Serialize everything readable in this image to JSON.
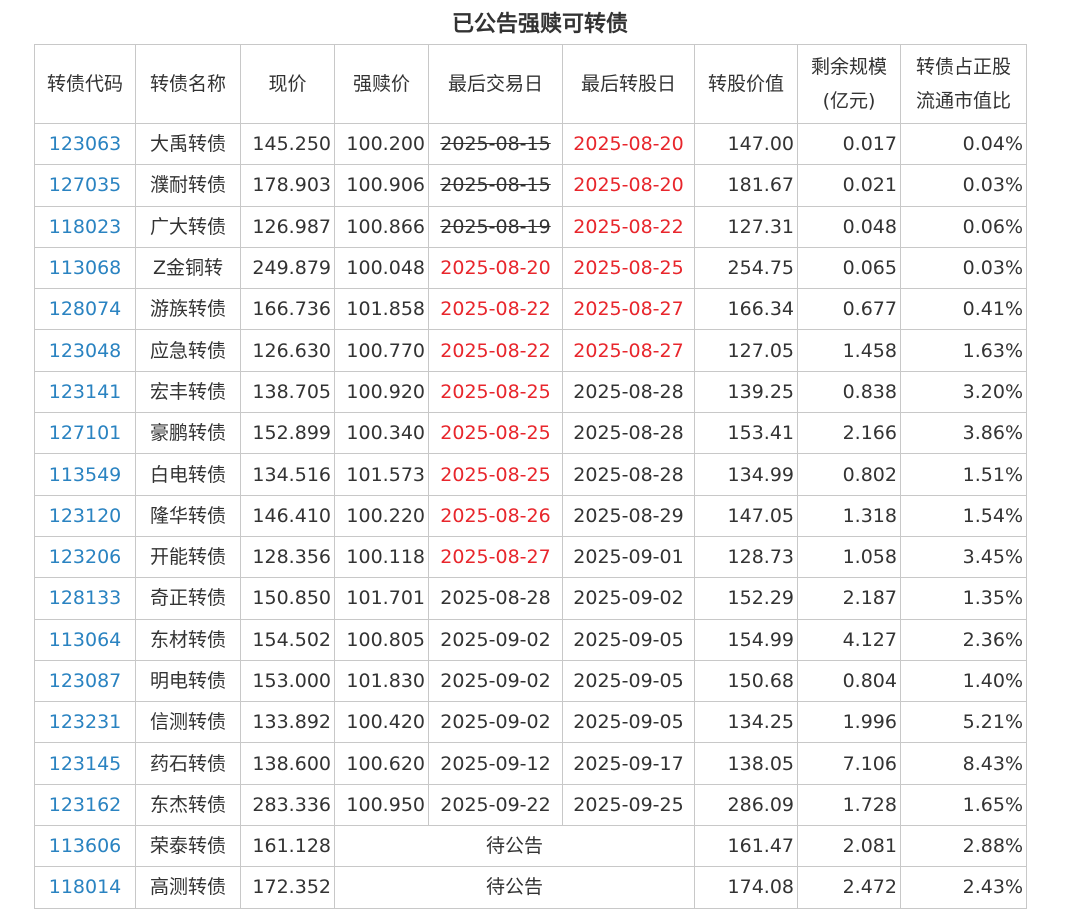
{
  "title": "已公告强赎可转债",
  "colors": {
    "code_link": "#2a83c1",
    "alert_red": "#e8262c",
    "grid": "#c8c8c8",
    "text": "#333333"
  },
  "headers": [
    [
      "转债代码"
    ],
    [
      "转债名称"
    ],
    [
      "现价"
    ],
    [
      "强赎价"
    ],
    [
      "最后交易日"
    ],
    [
      "最后转股日"
    ],
    [
      "转股价值"
    ],
    [
      "剩余规模",
      "(亿元)"
    ],
    [
      "转债占正股",
      "流通市值比"
    ]
  ],
  "rows": [
    {
      "code": "123063",
      "name": "大禹转债",
      "price": "145.250",
      "redeem": "100.200",
      "last_trade": "2025-08-15",
      "last_trade_style": "strike",
      "last_conv": "2025-08-20",
      "last_conv_style": "red",
      "conv_value": "147.00",
      "remain": "0.017",
      "ratio": "0.04%"
    },
    {
      "code": "127035",
      "name": "濮耐转债",
      "price": "178.903",
      "redeem": "100.906",
      "last_trade": "2025-08-15",
      "last_trade_style": "strike",
      "last_conv": "2025-08-20",
      "last_conv_style": "red",
      "conv_value": "181.67",
      "remain": "0.021",
      "ratio": "0.03%"
    },
    {
      "code": "118023",
      "name": "广大转债",
      "price": "126.987",
      "redeem": "100.866",
      "last_trade": "2025-08-19",
      "last_trade_style": "strike",
      "last_conv": "2025-08-22",
      "last_conv_style": "red",
      "conv_value": "127.31",
      "remain": "0.048",
      "ratio": "0.06%"
    },
    {
      "code": "113068",
      "name": "Z金铜转",
      "price": "249.879",
      "redeem": "100.048",
      "last_trade": "2025-08-20",
      "last_trade_style": "red",
      "last_conv": "2025-08-25",
      "last_conv_style": "red",
      "conv_value": "254.75",
      "remain": "0.065",
      "ratio": "0.03%"
    },
    {
      "code": "128074",
      "name": "游族转债",
      "price": "166.736",
      "redeem": "101.858",
      "last_trade": "2025-08-22",
      "last_trade_style": "red",
      "last_conv": "2025-08-27",
      "last_conv_style": "red",
      "conv_value": "166.34",
      "remain": "0.677",
      "ratio": "0.41%"
    },
    {
      "code": "123048",
      "name": "应急转债",
      "price": "126.630",
      "redeem": "100.770",
      "last_trade": "2025-08-22",
      "last_trade_style": "red",
      "last_conv": "2025-08-27",
      "last_conv_style": "red",
      "conv_value": "127.05",
      "remain": "1.458",
      "ratio": "1.63%"
    },
    {
      "code": "123141",
      "name": "宏丰转债",
      "price": "138.705",
      "redeem": "100.920",
      "last_trade": "2025-08-25",
      "last_trade_style": "red",
      "last_conv": "2025-08-28",
      "last_conv_style": "normal",
      "conv_value": "139.25",
      "remain": "0.838",
      "ratio": "3.20%"
    },
    {
      "code": "127101",
      "name": "豪鹏转债",
      "price": "152.899",
      "redeem": "100.340",
      "last_trade": "2025-08-25",
      "last_trade_style": "red",
      "last_conv": "2025-08-28",
      "last_conv_style": "normal",
      "conv_value": "153.41",
      "remain": "2.166",
      "ratio": "3.86%"
    },
    {
      "code": "113549",
      "name": "白电转债",
      "price": "134.516",
      "redeem": "101.573",
      "last_trade": "2025-08-25",
      "last_trade_style": "red",
      "last_conv": "2025-08-28",
      "last_conv_style": "normal",
      "conv_value": "134.99",
      "remain": "0.802",
      "ratio": "1.51%"
    },
    {
      "code": "123120",
      "name": "隆华转债",
      "price": "146.410",
      "redeem": "100.220",
      "last_trade": "2025-08-26",
      "last_trade_style": "red",
      "last_conv": "2025-08-29",
      "last_conv_style": "normal",
      "conv_value": "147.05",
      "remain": "1.318",
      "ratio": "1.54%"
    },
    {
      "code": "123206",
      "name": "开能转债",
      "price": "128.356",
      "redeem": "100.118",
      "last_trade": "2025-08-27",
      "last_trade_style": "red",
      "last_conv": "2025-09-01",
      "last_conv_style": "normal",
      "conv_value": "128.73",
      "remain": "1.058",
      "ratio": "3.45%"
    },
    {
      "code": "128133",
      "name": "奇正转债",
      "price": "150.850",
      "redeem": "101.701",
      "last_trade": "2025-08-28",
      "last_trade_style": "normal",
      "last_conv": "2025-09-02",
      "last_conv_style": "normal",
      "conv_value": "152.29",
      "remain": "2.187",
      "ratio": "1.35%"
    },
    {
      "code": "113064",
      "name": "东材转债",
      "price": "154.502",
      "redeem": "100.805",
      "last_trade": "2025-09-02",
      "last_trade_style": "normal",
      "last_conv": "2025-09-05",
      "last_conv_style": "normal",
      "conv_value": "154.99",
      "remain": "4.127",
      "ratio": "2.36%"
    },
    {
      "code": "123087",
      "name": "明电转债",
      "price": "153.000",
      "redeem": "101.830",
      "last_trade": "2025-09-02",
      "last_trade_style": "normal",
      "last_conv": "2025-09-05",
      "last_conv_style": "normal",
      "conv_value": "150.68",
      "remain": "0.804",
      "ratio": "1.40%"
    },
    {
      "code": "123231",
      "name": "信测转债",
      "price": "133.892",
      "redeem": "100.420",
      "last_trade": "2025-09-02",
      "last_trade_style": "normal",
      "last_conv": "2025-09-05",
      "last_conv_style": "normal",
      "conv_value": "134.25",
      "remain": "1.996",
      "ratio": "5.21%"
    },
    {
      "code": "123145",
      "name": "药石转债",
      "price": "138.600",
      "redeem": "100.620",
      "last_trade": "2025-09-12",
      "last_trade_style": "normal",
      "last_conv": "2025-09-17",
      "last_conv_style": "normal",
      "conv_value": "138.05",
      "remain": "7.106",
      "ratio": "8.43%"
    },
    {
      "code": "123162",
      "name": "东杰转债",
      "price": "283.336",
      "redeem": "100.950",
      "last_trade": "2025-09-22",
      "last_trade_style": "normal",
      "last_conv": "2025-09-25",
      "last_conv_style": "normal",
      "conv_value": "286.09",
      "remain": "1.728",
      "ratio": "1.65%"
    },
    {
      "code": "113606",
      "name": "荣泰转债",
      "price": "161.128",
      "pending": "待公告",
      "conv_value": "161.47",
      "remain": "2.081",
      "ratio": "2.88%"
    },
    {
      "code": "118014",
      "name": "高测转债",
      "price": "172.352",
      "pending": "待公告",
      "conv_value": "174.08",
      "remain": "2.472",
      "ratio": "2.43%"
    }
  ]
}
